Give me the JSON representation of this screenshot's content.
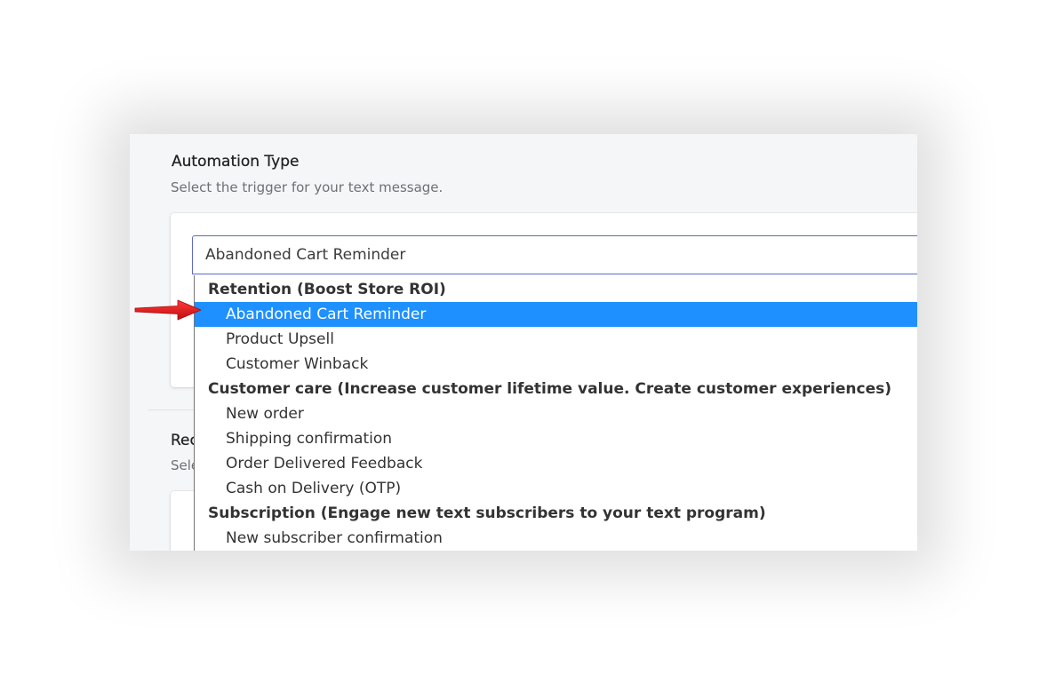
{
  "section": {
    "title": "Automation Type",
    "subtitle": "Select the trigger for your text message."
  },
  "section2": {
    "title_partial": "Rec",
    "subtitle_partial": "Sele"
  },
  "select": {
    "value": "Abandoned Cart Reminder"
  },
  "dropdown": {
    "groups": [
      {
        "label": "Retention (Boost Store ROI)",
        "options": [
          "Abandoned Cart Reminder",
          "Product Upsell",
          "Customer Winback"
        ]
      },
      {
        "label": "Customer care (Increase customer lifetime value. Create customer experiences)",
        "options": [
          "New order",
          "Shipping confirmation",
          "Order Delivered Feedback",
          "Cash on Delivery (OTP)"
        ]
      },
      {
        "label": "Subscription (Engage new text subscribers to your text program)",
        "options": [
          "New subscriber confirmation"
        ]
      }
    ],
    "selected_option": "Abandoned Cart Reminder"
  },
  "colors": {
    "accent_border": "#5c6ac4",
    "selected_bg": "#1e90ff",
    "arrow": "#e0151b"
  },
  "annotation": {
    "icon": "red-arrow-icon"
  }
}
